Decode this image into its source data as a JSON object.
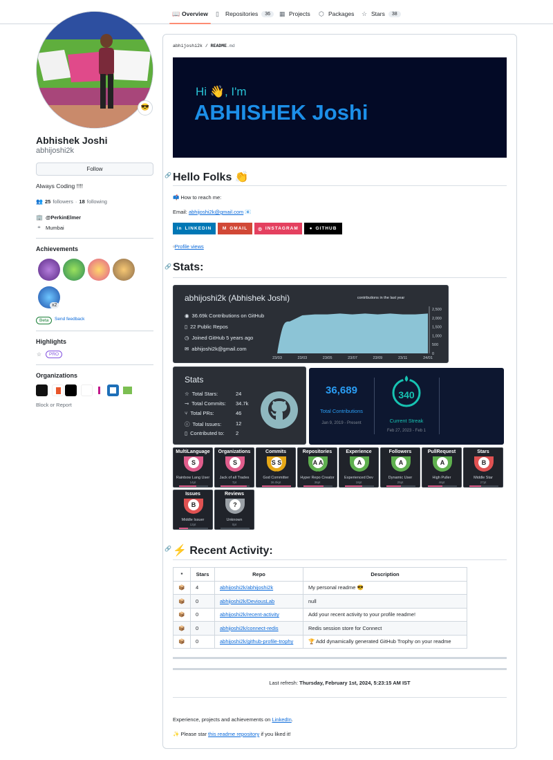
{
  "tabs": [
    {
      "label": "Overview",
      "icon": "book-icon",
      "count": ""
    },
    {
      "label": "Repositories",
      "icon": "repo-icon",
      "count": "36"
    },
    {
      "label": "Projects",
      "icon": "table-icon",
      "count": ""
    },
    {
      "label": "Packages",
      "icon": "package-icon",
      "count": ""
    },
    {
      "label": "Stars",
      "icon": "star-icon",
      "count": "38"
    }
  ],
  "profile": {
    "name": "Abhishek Joshi",
    "login": "abhijoshi2k",
    "follow_label": "Follow",
    "bio": "Always Coding !!!!",
    "followers_count": "25",
    "followers_label": "followers",
    "following_count": "18",
    "following_label": "following",
    "company": "@PerkinElmer",
    "location": "Mumbai",
    "status_emoji": "😎"
  },
  "achievements": {
    "heading": "Achievements",
    "multiplier": "x2",
    "beta": "Beta",
    "feedback": "Send feedback"
  },
  "highlights": {
    "heading": "Highlights",
    "pro": "PRO"
  },
  "organizations": {
    "heading": "Organizations",
    "block": "Block or Report"
  },
  "readme": {
    "crumb_user": "abhijoshi2k",
    "crumb_sep": "/",
    "crumb_file": "README",
    "crumb_ext": ".md",
    "banner_hi": "Hi 👋, I'm",
    "banner_name": "ABHISHEK Joshi",
    "hello_heading": "Hello Folks 👏",
    "reach": "📫 How to reach me:",
    "email_label": "Email:",
    "email": "abhijoshi2k@gmail.com",
    "email_emoji": "📧",
    "badges": [
      "LINKEDIN",
      "GMAIL",
      "INSTAGRAM",
      "GITHUB"
    ],
    "profile_views": "Profile views",
    "stats_heading": "Stats:",
    "activity_heading": "⚡ Recent Activity:",
    "last_refresh_label": "Last refresh:",
    "last_refresh": "Thursday, February 1st, 2024, 5:23:15 AM IST",
    "footer_text": "Experience, projects and achievements on",
    "footer_link": "LinkedIn",
    "star_prefix": "✨ Please star",
    "star_link": "this readme repository",
    "star_suffix": "if you liked it!"
  },
  "summary_card": {
    "title": "abhijoshi2k (Abhishek Joshi)",
    "lines": [
      "36.69k Contributions on GitHub",
      "22 Public Repos",
      "Joined GitHub 5 years ago",
      "abhijoshi2k@gmail.com"
    ],
    "chart_label": "contributions in the last year"
  },
  "chart_data": {
    "type": "area",
    "x": [
      "23/03",
      "23/03",
      "23/05",
      "23/07",
      "23/09",
      "23/11",
      "24/01"
    ],
    "values": [
      0,
      1800,
      2150,
      2200,
      2200,
      2250,
      2200,
      2250,
      2200,
      2250,
      2200,
      2200,
      2250
    ],
    "yticks": [
      "2,500",
      "2,000",
      "1,500",
      "1,000",
      "500",
      "0"
    ],
    "ylim": [
      0,
      2500
    ],
    "title": "contributions in the last year"
  },
  "stats_card": {
    "title": "Stats",
    "rows": [
      {
        "label": "Total Stars:",
        "value": "24"
      },
      {
        "label": "Total Commits:",
        "value": "34.7k"
      },
      {
        "label": "Total PRs:",
        "value": "46"
      },
      {
        "label": "Total Issues:",
        "value": "12"
      },
      {
        "label": "Contributed to:",
        "value": "2"
      }
    ]
  },
  "streak_card": {
    "total": "36,689",
    "total_label": "Total Contributions",
    "total_range": "Jan 9, 2019 - Present",
    "streak": "340",
    "streak_label": "Current Streak",
    "streak_range": "Feb 27, 2023 - Feb 1"
  },
  "trophies": [
    {
      "title": "MultiLanguage",
      "rank": "S",
      "name": "Rainbow Lang User",
      "pt": "14pt",
      "color": "#e05d8c",
      "fill": 0.6
    },
    {
      "title": "Organizations",
      "rank": "S",
      "name": "Jack of all Trades",
      "pt": "7pt",
      "color": "#e05d8c",
      "fill": 0.9
    },
    {
      "title": "Commits",
      "rank": "S S S",
      "name": "God Committer",
      "pt": "36.0kpt",
      "color": "#e6a817",
      "fill": 1.0
    },
    {
      "title": "Repositories",
      "rank": "A A A",
      "name": "Hyper Repo Creator",
      "pt": "36pt",
      "color": "#5fb04f",
      "fill": 0.7
    },
    {
      "title": "Experience",
      "rank": "A",
      "name": "Experienced Dev",
      "pt": "18pt",
      "color": "#5fb04f",
      "fill": 0.6
    },
    {
      "title": "Followers",
      "rank": "A",
      "name": "Dynamic User",
      "pt": "25pt",
      "color": "#5fb04f",
      "fill": 0.5
    },
    {
      "title": "PullRequest",
      "rank": "A",
      "name": "High Puller",
      "pt": "46pt",
      "color": "#5fb04f",
      "fill": 0.5
    },
    {
      "title": "Stars",
      "rank": "B",
      "name": "Middle Star",
      "pt": "27pt",
      "color": "#e05252",
      "fill": 0.4
    },
    {
      "title": "Issues",
      "rank": "B",
      "name": "Middle Issuer",
      "pt": "12pt",
      "color": "#e05252",
      "fill": 0.3
    },
    {
      "title": "Reviews",
      "rank": "?",
      "name": "Unknown",
      "pt": "0pt",
      "color": "#9aa0a6",
      "fill": 0.0
    }
  ],
  "activity_table": {
    "headers": [
      "*",
      "Stars",
      "Repo",
      "Description"
    ],
    "rows": [
      {
        "icon": "📦",
        "stars": "4",
        "repo": "abhijoshi2k/abhijoshi2k",
        "desc": "My personal readme 😎"
      },
      {
        "icon": "📦",
        "stars": "0",
        "repo": "abhijoshi2k/DeviousLab",
        "desc": "null"
      },
      {
        "icon": "📦",
        "stars": "0",
        "repo": "abhijoshi2k/recent-activity",
        "desc": "Add your recent activity to your profile readme!"
      },
      {
        "icon": "📦",
        "stars": "0",
        "repo": "abhijoshi2k/connect-redis",
        "desc": "Redis session store for Connect"
      },
      {
        "icon": "📦",
        "stars": "0",
        "repo": "abhijoshi2k/github-profile-trophy",
        "desc": "🏆 Add dynamically generated GitHub Trophy on your readme"
      }
    ]
  }
}
